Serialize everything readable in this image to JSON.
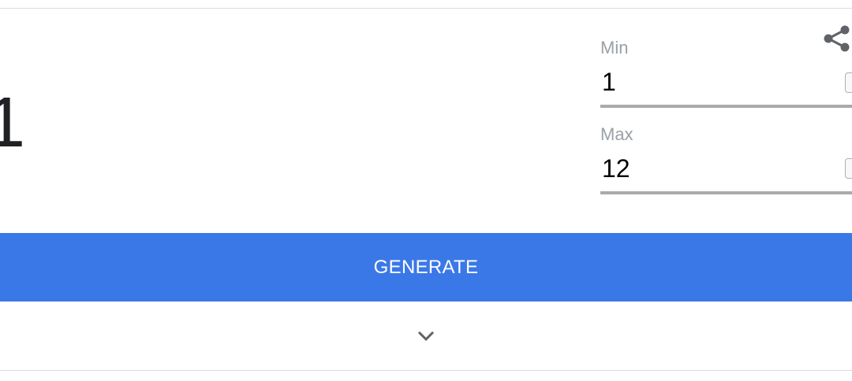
{
  "result": {
    "value": "1"
  },
  "min": {
    "label": "Min",
    "value": "1"
  },
  "max": {
    "label": "Max",
    "value": "12"
  },
  "generate": {
    "label": "GENERATE"
  },
  "colors": {
    "accent": "#3b78e7",
    "label_gray": "#9aa0a6",
    "underline_gray": "#aaaaaa",
    "icon_gray": "#5f6368"
  },
  "icons": {
    "share": "share-icon",
    "expand": "chevron-down-icon"
  }
}
